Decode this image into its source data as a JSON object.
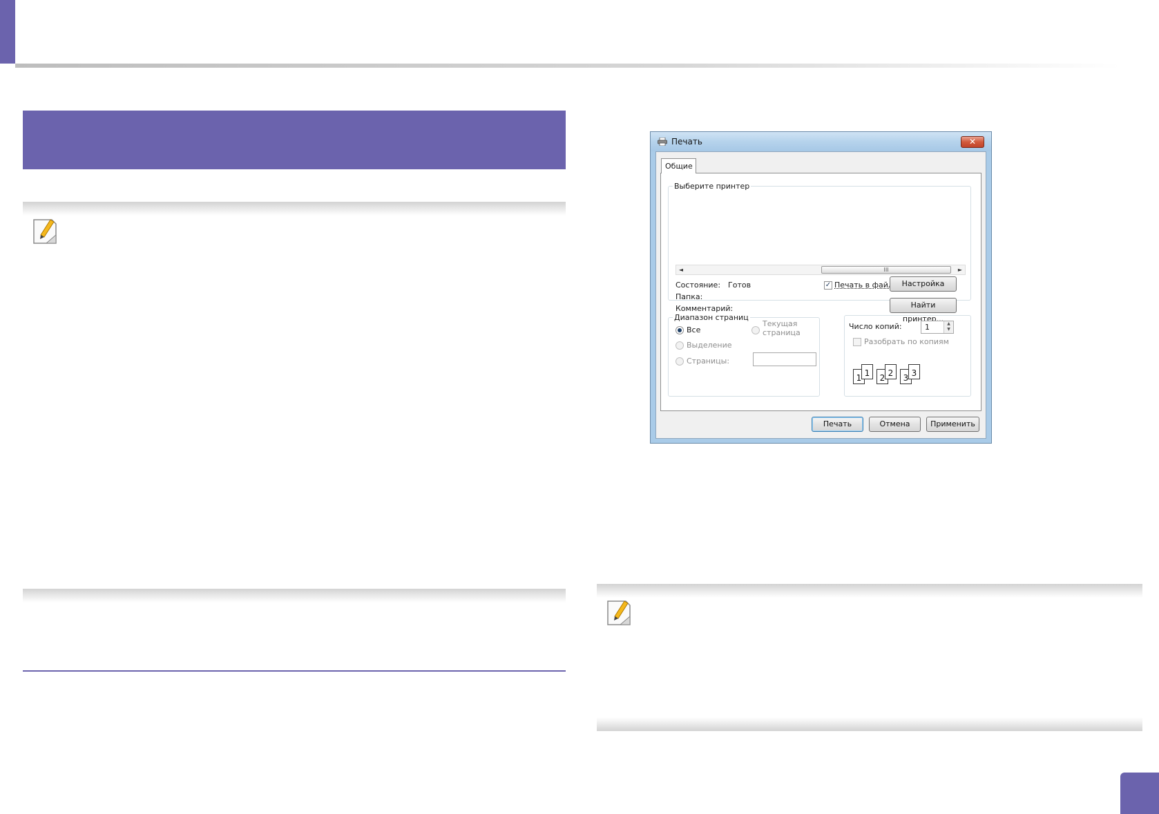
{
  "dialog": {
    "title": "Печать",
    "close_glyph": "✕",
    "tab_label": "Общие",
    "printer_group": {
      "legend": "Выберите принтер",
      "scroll_left": "◄",
      "scroll_right": "►",
      "scroll_grip": "III",
      "status_label": "Состояние:",
      "status_value": "Готов",
      "folder_label": "Папка:",
      "comment_label": "Комментарий:",
      "print_to_file_label": "Печать в файл",
      "print_to_file_checked": true,
      "settings_button": "Настройка",
      "find_printer_button": "Найти принтер..."
    },
    "range_group": {
      "legend": "Диапазон страниц",
      "all": "Все",
      "selection": "Выделение",
      "current_page_line1": "Текущая",
      "current_page_line2": "страница",
      "pages": "Страницы:",
      "pages_value": ""
    },
    "copies_group": {
      "copies_label": "Число копий:",
      "copies_value": "1",
      "collate_label": "Разобрать по копиям",
      "collate_checked": false,
      "page_numbers": [
        "1",
        "1",
        "2",
        "2",
        "3",
        "3"
      ]
    },
    "buttons": {
      "print": "Печать",
      "cancel": "Отмена",
      "apply": "Применить"
    }
  },
  "colors": {
    "accent": "#6b63ad"
  }
}
